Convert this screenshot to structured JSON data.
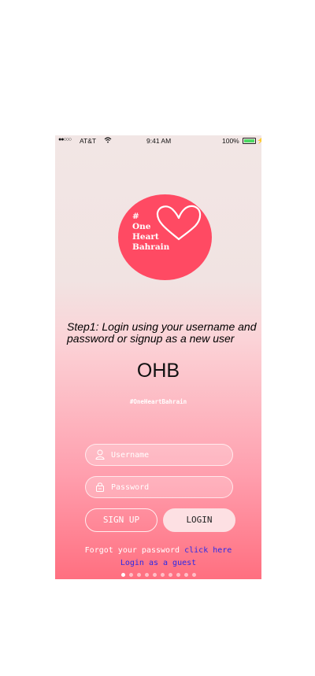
{
  "status_bar": {
    "signal": "●●○○○",
    "carrier": "AT&T",
    "time": "9:41 AM",
    "battery_percent": "100%"
  },
  "logo": {
    "line1": "#",
    "line2": "One",
    "line3": "Heart",
    "line4": "Bahrain",
    "color": "#ff4a63"
  },
  "instruction": "Step1: Login using your username and password or signup as a new user",
  "app_title": "OHB",
  "hashtag": "#OneHeartBahrain",
  "login_form": {
    "username_placeholder": "Username",
    "password_placeholder": "Password",
    "signup_label": "SIGN UP",
    "login_label": "LOGIN"
  },
  "footer": {
    "forgot_text": "Forgot your password",
    "forgot_link": "click here",
    "guest_link": "Login as a guest"
  },
  "pager": {
    "total": 10,
    "active": 1
  }
}
